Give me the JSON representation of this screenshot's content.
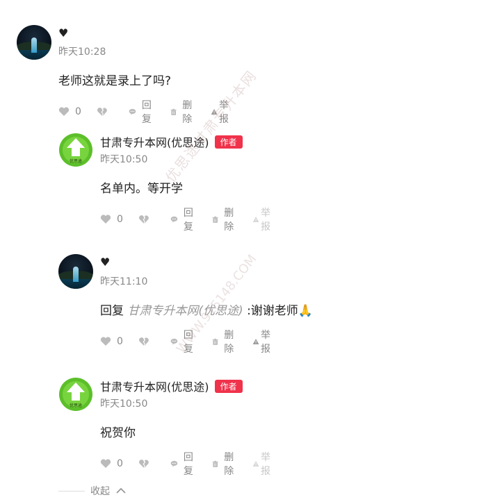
{
  "comments": [
    {
      "user": "♥",
      "time": "昨天10:28",
      "text": "老师这就是录上了吗?",
      "likes": "0",
      "reply": "回复",
      "delete": "删除",
      "report": "举报",
      "avatar": "night-fountain"
    },
    {
      "user": "甘肃专升本网(优思途)",
      "badge": "作者",
      "time": "昨天10:50",
      "text": "名单内。等开学",
      "likes": "0",
      "reply": "回复",
      "delete": "删除",
      "report": "举报",
      "avatar": "green-arrow"
    },
    {
      "user": "♥",
      "time": "昨天11:10",
      "reply_prefix": "回复",
      "reply_target": "甘肃专升本网(优思途)",
      "text": ":谢谢老师🙏",
      "likes": "0",
      "reply": "回复",
      "delete": "删除",
      "report": "举报",
      "avatar": "night-fountain"
    },
    {
      "user": "甘肃专升本网(优思途)",
      "badge": "作者",
      "time": "昨天10:50",
      "text": "祝贺你",
      "likes": "0",
      "reply": "回复",
      "delete": "删除",
      "report": "举报",
      "avatar": "green-arrow"
    }
  ],
  "avatar_logo_text": "优思途",
  "collapse_label": "收起",
  "watermark": {
    "line1": "优思途甘肃专升本网",
    "line2": "WWW.915148.COM"
  },
  "colors": {
    "badge": "#f0324b",
    "muted": "#888888",
    "disabled": "#c8c8c8"
  }
}
